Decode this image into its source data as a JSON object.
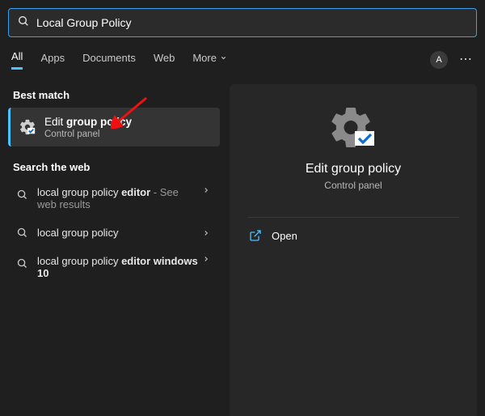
{
  "search": {
    "query": "Local Group Policy"
  },
  "tabs": {
    "all": "All",
    "apps": "Apps",
    "documents": "Documents",
    "web": "Web",
    "more": "More"
  },
  "avatar_initial": "A",
  "sections": {
    "best_match": "Best match",
    "search_web": "Search the web"
  },
  "best_match": {
    "title_pre": "Edit ",
    "title_bold": "group policy",
    "subtitle": "Control panel"
  },
  "web_results": [
    {
      "pre": "local group policy ",
      "bold": "editor",
      "suffix": " - See web results"
    },
    {
      "pre": "local group policy",
      "bold": "",
      "suffix": ""
    },
    {
      "pre": "local group policy ",
      "bold": "editor windows 10",
      "suffix": ""
    }
  ],
  "preview": {
    "title": "Edit group policy",
    "subtitle": "Control panel",
    "open_label": "Open"
  }
}
